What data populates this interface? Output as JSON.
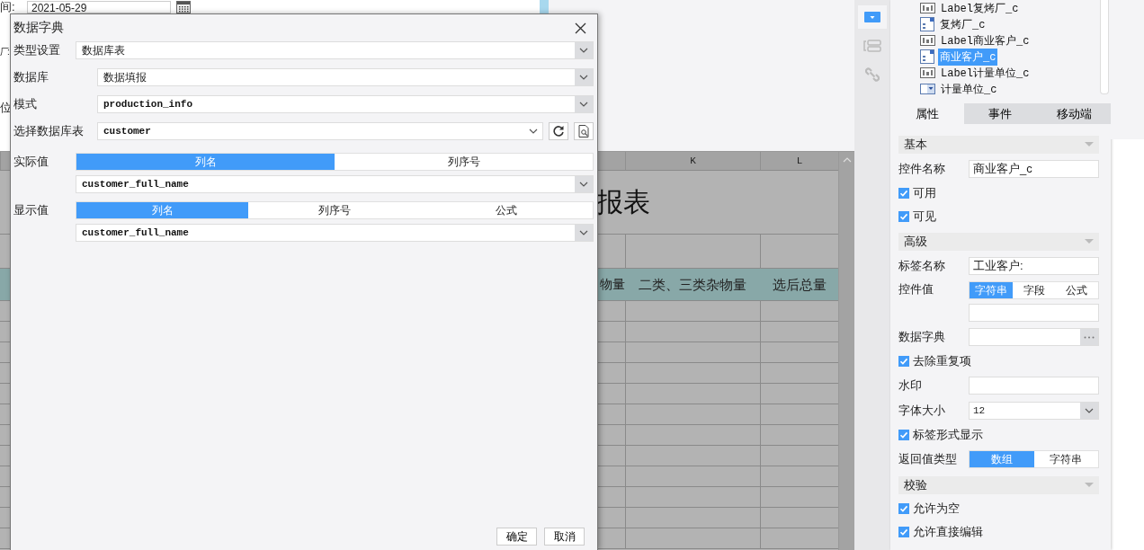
{
  "form": {
    "date_label": "间:",
    "date_value": "2021-05-29",
    "label_2": "厂:",
    "label_3": "位"
  },
  "sheet": {
    "columns": [
      "K",
      "L"
    ],
    "title": "报表",
    "headers": [
      "物量",
      "二类、三类杂物量",
      "选后总量"
    ]
  },
  "dialog": {
    "title": "数据字典",
    "rows": [
      {
        "kind": "select",
        "label": "类型设置",
        "value": "数据库表",
        "mono": false,
        "wide": true
      },
      {
        "kind": "select",
        "label": "数据库",
        "value": "数据填报",
        "mono": false,
        "wide": false
      },
      {
        "kind": "select",
        "label": "模式",
        "value": "production_info",
        "mono": true,
        "wide": false
      },
      {
        "kind": "table",
        "label": "选择数据库表",
        "value": "customer",
        "mono": true,
        "wide": false
      }
    ],
    "values": [
      {
        "label": "实际值",
        "segments": [
          {
            "label": "列名",
            "selected": true
          },
          {
            "label": "列序号",
            "selected": false
          }
        ],
        "value": "customer_full_name"
      },
      {
        "label": "显示值",
        "segments": [
          {
            "label": "列名",
            "selected": true
          },
          {
            "label": "列序号",
            "selected": false
          },
          {
            "label": "公式",
            "selected": false
          }
        ],
        "value": "customer_full_name"
      }
    ],
    "buttons": [
      "确定",
      "取消"
    ]
  },
  "toolbar": [
    {
      "kind": "widget",
      "selected": true
    },
    {
      "kind": "layout",
      "selected": false
    },
    {
      "kind": "link",
      "selected": false
    }
  ],
  "tree": [
    {
      "kind": "label",
      "text": "Label复烤厂_c",
      "selected": false
    },
    {
      "kind": "list",
      "text": "复烤厂_c",
      "selected": false
    },
    {
      "kind": "label",
      "text": "Label商业客户_c",
      "selected": false
    },
    {
      "kind": "list",
      "text": "商业客户_c",
      "selected": true
    },
    {
      "kind": "label",
      "text": "Label计量单位_c",
      "selected": false
    },
    {
      "kind": "combo",
      "text": "计量单位_c",
      "selected": false
    }
  ],
  "tabs": [
    {
      "label": "属性",
      "selected": true
    },
    {
      "label": "事件",
      "selected": false
    },
    {
      "label": "移动端",
      "selected": false
    }
  ],
  "properties": [
    {
      "kind": "header",
      "label": "基本"
    },
    {
      "kind": "field",
      "label": "控件名称",
      "value": "商业客户_c"
    },
    {
      "kind": "checkbox",
      "label": "可用",
      "checked": true
    },
    {
      "kind": "checkbox",
      "label": "可见",
      "checked": true
    },
    {
      "kind": "header",
      "label": "高级"
    },
    {
      "kind": "field",
      "label": "标签名称",
      "value": "工业客户:"
    },
    {
      "kind": "segmented",
      "label": "控件值",
      "segments": [
        {
          "label": "字符串",
          "selected": true
        },
        {
          "label": "字段",
          "selected": false
        },
        {
          "label": "公式",
          "selected": false
        }
      ]
    },
    {
      "kind": "more",
      "label": "数据字典"
    },
    {
      "kind": "checkbox",
      "label": "去除重复项",
      "checked": true
    },
    {
      "kind": "field",
      "label": "水印"
    },
    {
      "kind": "select",
      "label": "字体大小",
      "value": "12"
    },
    {
      "kind": "checkbox",
      "label": "标签形式显示",
      "checked": true
    },
    {
      "kind": "choice",
      "label": "返回值类型",
      "segments": [
        {
          "label": "数组",
          "selected": true
        },
        {
          "label": "字符串",
          "selected": false
        }
      ]
    },
    {
      "kind": "header",
      "label": "校验"
    },
    {
      "kind": "checkbox",
      "label": "允许为空",
      "checked": true
    },
    {
      "kind": "checkbox",
      "label": "允许直接编辑",
      "checked": true
    }
  ]
}
